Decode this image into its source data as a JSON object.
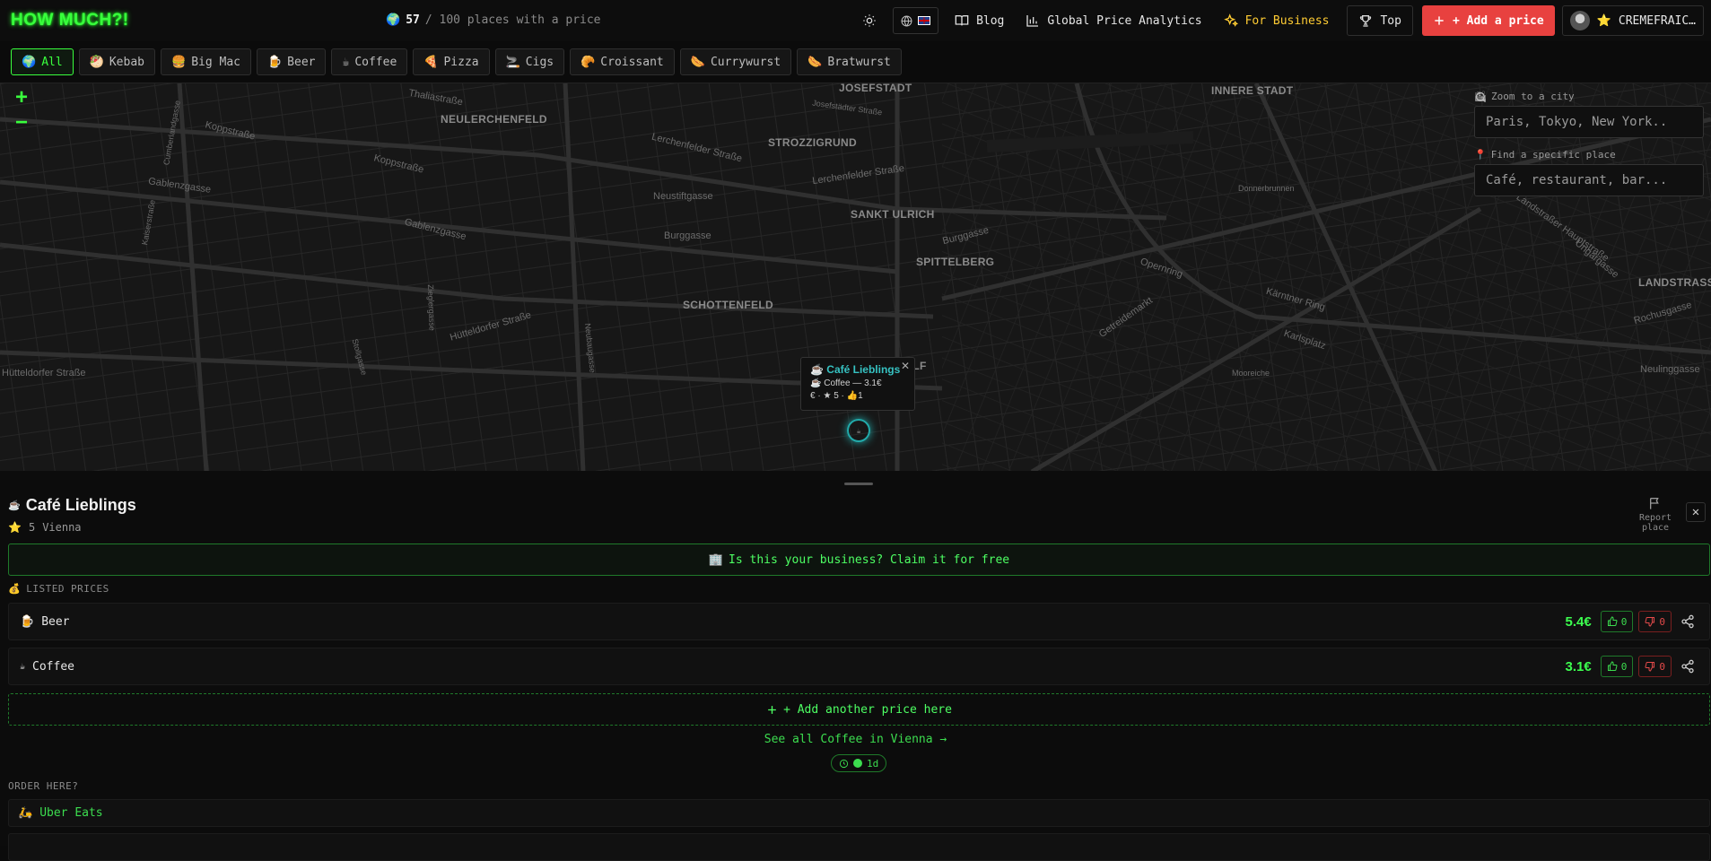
{
  "header": {
    "logo": "HOW MUCH?!",
    "counter_value": "57",
    "counter_text": "/ 100 places with a price",
    "nav": {
      "blog": "Blog",
      "analytics": "Global Price Analytics",
      "business": "For Business",
      "top": "Top",
      "add_price": "+ Add a price",
      "user": "CREMEFRAIC…"
    }
  },
  "categories": [
    "All",
    "Kebab",
    "Big Mac",
    "Beer",
    "Coffee",
    "Pizza",
    "Cigs",
    "Croissant",
    "Currywurst",
    "Bratwurst"
  ],
  "category_icons": [
    "🌍",
    "🥙",
    "🍔",
    "🍺",
    "☕",
    "🍕",
    "🚬",
    "🥐",
    "🌭",
    "🌭"
  ],
  "map": {
    "districts": [
      "JOSEFSTADT",
      "INNERE STADT",
      "NEULERCHENFELD",
      "STROZZIGRUND",
      "SANKT ULRICH",
      "SPITTELBERG",
      "SCHOTTENFELD",
      "MARIAHILF",
      "LANDSTRASS"
    ],
    "streets": [
      "Thaliastraße",
      "Koppstraße",
      "Lerchenfelder Straße",
      "Neustiftgasse",
      "Burggasse",
      "Gablenzgasse",
      "Hütteldorfer Straße",
      "Opernring",
      "Kärntner Ring",
      "Karlsplatz",
      "Getreidemarkt",
      "Donnerbrunnen",
      "Mooreiche",
      "Neulinggasse",
      "Ungargasse",
      "Rochusgasse",
      "Landstraßer Hauptstraße",
      "Josefstädter Straße",
      "Zieglergasse",
      "Neubaugasse",
      "Stollgasse",
      "Cumberlandgasse",
      "Kaiserstraße"
    ],
    "zoom_in": "+",
    "zoom_out": "−",
    "city_label": "Zoom to a city",
    "city_placeholder": "Paris, Tokyo, New York...",
    "place_label": "Find a specific place",
    "place_placeholder": "Café, restaurant, bar...",
    "popup": {
      "title": "Café Lieblings",
      "line1": "Coffee — 3.1€",
      "line2": "€ · ★ 5 · 👍1"
    }
  },
  "place": {
    "name": "Café Lieblings",
    "rating": "5",
    "city": "Vienna",
    "report": "Report place",
    "claim": "Is this your business? Claim it for free",
    "listed_prices_label": "LISTED PRICES",
    "prices": [
      {
        "icon": "🍺",
        "name": "Beer",
        "price": "5.4€",
        "up": "0",
        "down": "0"
      },
      {
        "icon": "☕",
        "name": "Coffee",
        "price": "3.1€",
        "up": "0",
        "down": "0"
      }
    ],
    "add_another": "+ Add another price here",
    "see_all": "See all Coffee in Vienna →",
    "age": "1d",
    "order_label": "ORDER HERE?",
    "order_services": [
      "Uber Eats"
    ]
  },
  "colors": {
    "accent_green": "#39ff3d",
    "add_red": "#e8413f",
    "business_yellow": "#ffcc33",
    "popup_teal": "#36c2c2"
  }
}
